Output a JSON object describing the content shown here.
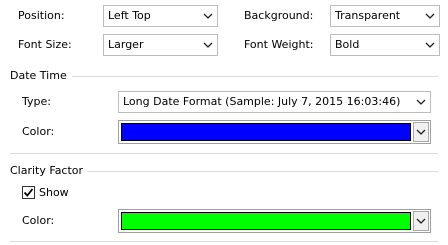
{
  "general": {
    "position_label": "Position:",
    "position_value": "Left Top",
    "background_label": "Background:",
    "background_value": "Transparent",
    "font_size_label": "Font Size:",
    "font_size_value": "Larger",
    "font_weight_label": "Font Weight:",
    "font_weight_value": "Bold"
  },
  "date_time": {
    "title": "Date Time",
    "type_label": "Type:",
    "type_value": "Long Date Format (Sample: July 7, 2015 16:03:46)",
    "color_label": "Color:",
    "color_value": "#0000ff"
  },
  "clarity": {
    "title": "Clarity Factor",
    "show_label": "Show",
    "show_checked": true,
    "color_label": "Color:",
    "color_value": "#00ff00"
  },
  "icons": {
    "dropdown": "chevron-down-icon",
    "checkmark": "checkmark-icon"
  }
}
